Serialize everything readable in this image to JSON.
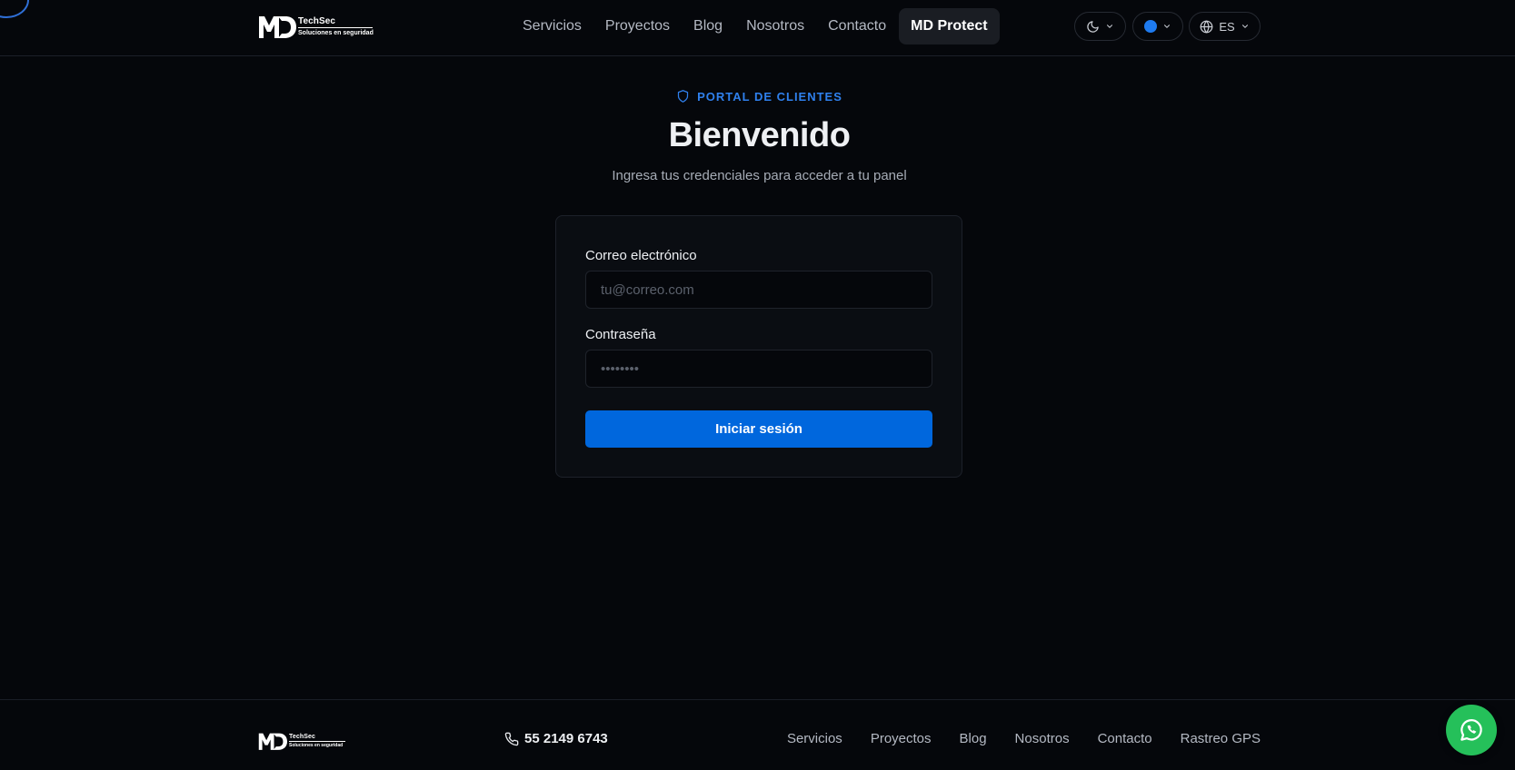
{
  "header": {
    "logo": {
      "brand": "TechSec",
      "tagline": "Soluciones en seguridad"
    },
    "nav": [
      {
        "label": "Servicios"
      },
      {
        "label": "Proyectos"
      },
      {
        "label": "Blog"
      },
      {
        "label": "Nosotros"
      },
      {
        "label": "Contacto"
      },
      {
        "label": "MD Protect",
        "active": true
      }
    ],
    "theme_toggle": {
      "icon": "moon-icon"
    },
    "color_picker": {
      "color": "#1e7bf0"
    },
    "language": {
      "icon": "globe-icon",
      "value": "ES"
    }
  },
  "main": {
    "badge": "PORTAL DE CLIENTES",
    "title": "Bienvenido",
    "subtitle": "Ingresa tus credenciales para acceder a tu panel",
    "form": {
      "email_label": "Correo electrónico",
      "email_placeholder": "tu@correo.com",
      "password_label": "Contraseña",
      "password_placeholder": "••••••••",
      "submit": "Iniciar sesión"
    }
  },
  "footer": {
    "logo": {
      "brand": "TechSec",
      "tagline": "Soluciones en seguridad"
    },
    "phone": "55 2149 6743",
    "nav": [
      {
        "label": "Servicios"
      },
      {
        "label": "Proyectos"
      },
      {
        "label": "Blog"
      },
      {
        "label": "Nosotros"
      },
      {
        "label": "Contacto"
      },
      {
        "label": "Rastreo GPS"
      }
    ]
  },
  "colors": {
    "accent": "#0067dd",
    "badge": "#2f80ed",
    "whatsapp": "#25c05a",
    "background": "#05070b"
  }
}
